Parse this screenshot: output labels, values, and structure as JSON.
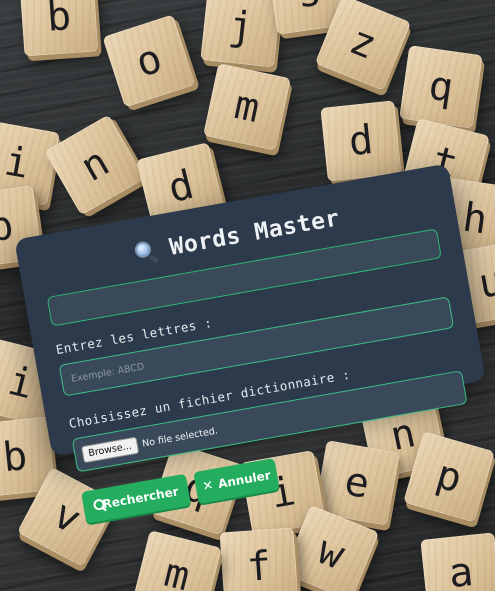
{
  "app": {
    "title": "Words Master",
    "title_icon": "magnifier-icon"
  },
  "form": {
    "letters_label": "Entrez les lettres :",
    "letters_value": "",
    "letters_placeholder": "Exemple: ABCD",
    "file_label": "Choisissez un fichier dictionnaire :",
    "browse_label": "Browse...",
    "file_status": "No file selected."
  },
  "buttons": {
    "search_label": "Rechercher",
    "search_icon": "search-icon",
    "cancel_label": "Annuler",
    "cancel_icon": "close-icon",
    "cancel_glyph": "✕"
  },
  "background_tiles": [
    "b",
    "j",
    "s",
    "z",
    "o",
    "q",
    "m",
    "d",
    "i",
    "n",
    "d",
    "t",
    "h",
    "u",
    "b",
    "n",
    "e",
    "i",
    "b",
    "q",
    "p",
    "i",
    "w",
    "f",
    "m",
    "a",
    "v"
  ],
  "colors": {
    "card": "#2c3a4b",
    "field": "#3a495a",
    "accent_green": "#24ad5e",
    "field_border": "#3bbf86"
  }
}
